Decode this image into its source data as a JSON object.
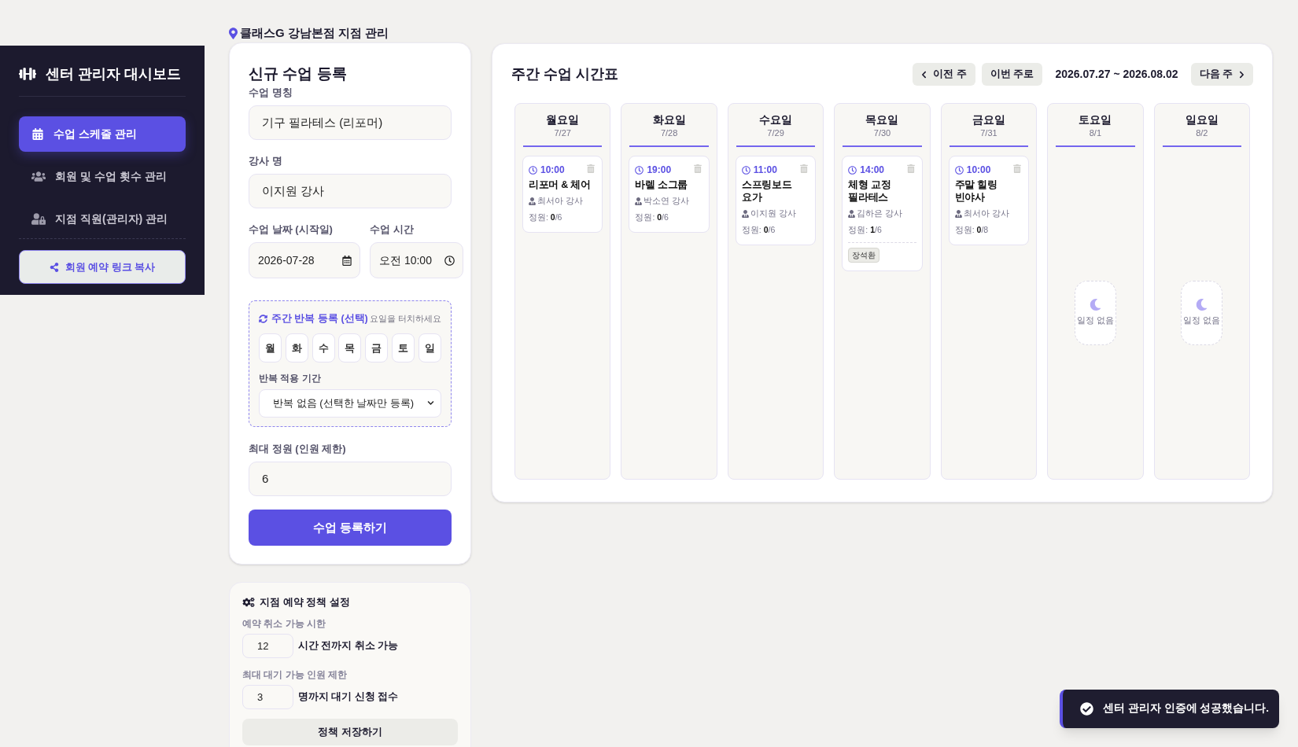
{
  "sidebar": {
    "title": "센터 관리자 대시보드",
    "items": [
      {
        "label": "수업 스케줄 관리",
        "selected": true
      },
      {
        "label": "회원 및 수업 횟수 관리",
        "selected": false
      },
      {
        "label": "지점 직원(관리자) 관리",
        "selected": false
      }
    ],
    "share_button": "회원 예약 링크 복사"
  },
  "branch_header": "클래스G 강남본점 지점 관리",
  "class_form": {
    "title": "신규 수업 등록",
    "name_field": {
      "label": "수업 명칭",
      "value": "기구 필라테스 (리포머)"
    },
    "instructor_field": {
      "label": "강사 명",
      "value": "이지원 강사"
    },
    "date_field": {
      "label": "수업 날짜 (시작일)",
      "value": "2026-07-28"
    },
    "time_field": {
      "label": "수업 시간",
      "value": "오전 10:00"
    },
    "repeat": {
      "title": "주간 반복 등록 (선택)",
      "hint": "요일을 터치하세요",
      "days": [
        {
          "label": "월",
          "selected": false
        },
        {
          "label": "화",
          "selected": false
        },
        {
          "label": "수",
          "selected": false
        },
        {
          "label": "목",
          "selected": false
        },
        {
          "label": "금",
          "selected": false
        },
        {
          "label": "토",
          "selected": false
        },
        {
          "label": "일",
          "selected": false
        }
      ],
      "period_label": "반복 적용 기간",
      "period_value": "반복 없음 (선택한 날짜만 등록)"
    },
    "capacity_field": {
      "label": "최대 정원 (인원 제한)",
      "value": "6"
    },
    "submit_button": "수업 등록하기"
  },
  "policy": {
    "title": "지점 예약 정책 설정",
    "rows": [
      {
        "label": "예약 취소 가능 시한",
        "value": "12",
        "suffix": "시간 전까지 취소 가능"
      },
      {
        "label": "최대 대기 가능 인원 제한",
        "value": "3",
        "suffix": "명까지 대기 신청 접수"
      }
    ],
    "save_button": "정책 저장하기"
  },
  "schedule": {
    "title": "주간 수업 시간표",
    "prev_button": "이전 주",
    "today_button": "이번 주로",
    "range": "2026.07.27 ~ 2026.08.02",
    "next_button": "다음 주",
    "days": [
      {
        "name": "월요일",
        "date": "7/27",
        "classes": [
          {
            "time": "10:00",
            "title": "리포머 & 체어",
            "instructor": "최서아 강사",
            "capacity": "정원: **0**/6"
          }
        ]
      },
      {
        "name": "화요일",
        "date": "7/28",
        "classes": [
          {
            "time": "19:00",
            "title": "바렐 소그룹",
            "instructor": "박소연 강사",
            "capacity": "정원: **0**/6"
          }
        ]
      },
      {
        "name": "수요일",
        "date": "7/29",
        "classes": [
          {
            "time": "11:00",
            "title": "스프링보드 요가",
            "instructor": "이지원 강사",
            "capacity": "정원: **0**/6"
          }
        ]
      },
      {
        "name": "목요일",
        "date": "7/30",
        "classes": [
          {
            "time": "14:00",
            "title": "체형 교정 필라테스",
            "instructor": "김하은 강사",
            "capacity": "정원: **1**/6",
            "attendees": [
              "장석환"
            ]
          }
        ]
      },
      {
        "name": "금요일",
        "date": "7/31",
        "classes": [
          {
            "time": "10:00",
            "title": "주말 힐링 빈야사",
            "instructor": "최서아 강사",
            "capacity": "정원: **0**/8"
          }
        ]
      },
      {
        "name": "토요일",
        "date": "8/1",
        "empty_text": "일정 없음"
      },
      {
        "name": "일요일",
        "date": "8/2",
        "empty_text": "일정 없음"
      }
    ]
  },
  "toast": {
    "message": "센터 관리자 인증에 성공했습니다."
  }
}
